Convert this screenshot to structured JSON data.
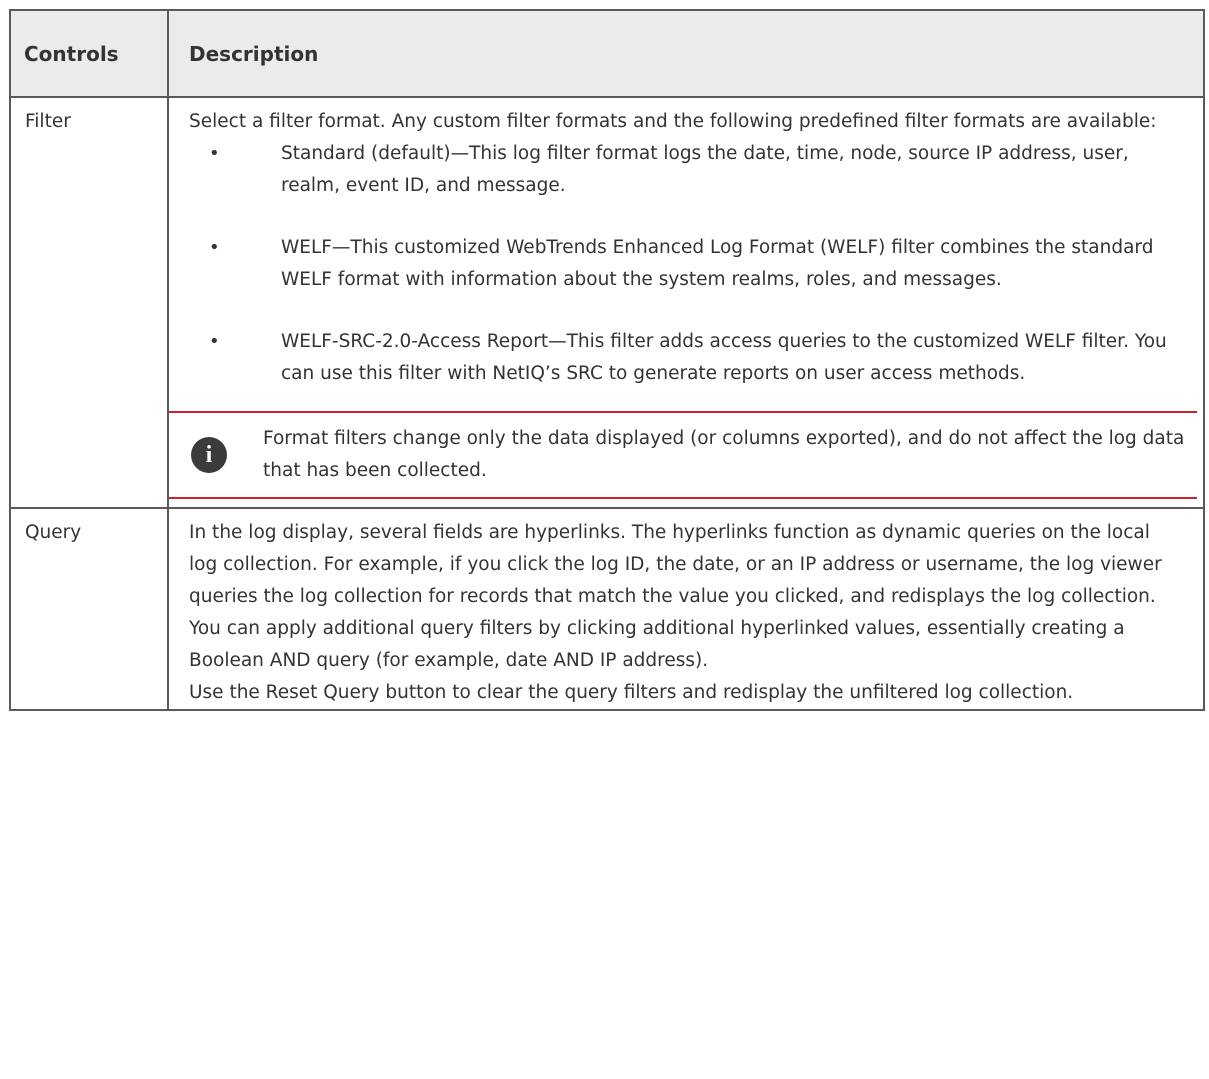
{
  "table": {
    "headers": {
      "controls": "Controls",
      "description": "Description"
    },
    "rows": [
      {
        "control": "Filter",
        "intro": "Select a filter format. Any custom filter formats and the following predefined filter formats are available:",
        "bullets": [
          "Standard (default)—This log filter format logs the date, time, node, source IP address, user, realm, event ID, and message.",
          "WELF—This customized WebTrends Enhanced Log Format (WELF) filter combines the standard WELF format with information about the system realms, roles, and messages.",
          "WELF-SRC-2.0-Access Report—This filter adds access queries to the customized WELF filter. You can use this filter with NetIQ’s SRC to generate reports on user access methods."
        ],
        "note": {
          "icon": "info-icon",
          "text": "Format filters change only the data displayed (or columns exported), and do not affect the log data that has been collected."
        }
      },
      {
        "control": "Query",
        "paragraphs": [
          "In the log display, several fields are hyperlinks. The hyperlinks function as dynamic queries on the local log collection. For example, if you click the log ID, the date, or an IP address or username, the log viewer queries the log collection for records that match the value you clicked, and redisplays the log collection. You can apply additional query filters by clicking additional hyperlinked values, essentially creating a Boolean AND query (for example, date AND IP address).",
          "Use the Reset Query button to clear the query filters and redisplay the unfiltered log collection."
        ]
      }
    ]
  },
  "colors": {
    "header_bg": "#ebebeb",
    "border": "#5a5a5a",
    "note_rule": "#d11f2b",
    "icon_bg": "#3b3b3b"
  }
}
